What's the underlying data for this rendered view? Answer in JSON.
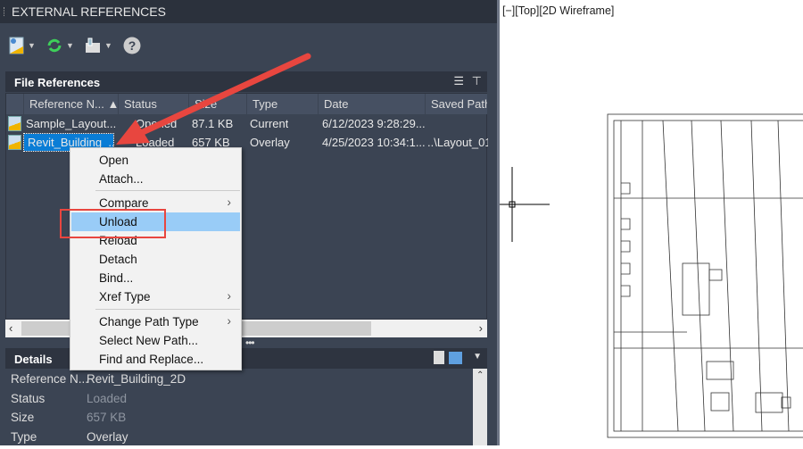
{
  "palette": {
    "title": "EXTERNAL REFERENCES"
  },
  "toolbar": {
    "icons": [
      "attach-dwg-icon",
      "refresh-icon",
      "change-path-icon",
      "help-icon"
    ]
  },
  "file_references": {
    "title": "File References",
    "columns": [
      "Reference N...",
      "Status",
      "Size",
      "Type",
      "Date",
      "Saved Path"
    ],
    "rows": [
      {
        "name": "Sample_Layout...",
        "status": "Opened",
        "size": "87.1 KB",
        "type": "Current",
        "date": "6/12/2023 9:28:29...",
        "saved_path": ""
      },
      {
        "name": "Revit_Building_...",
        "status": "Loaded",
        "size": "657 KB",
        "type": "Overlay",
        "date": "4/25/2023 10:34:1...",
        "saved_path": "..\\Layout_01"
      }
    ]
  },
  "context_menu": {
    "items": [
      {
        "label": "Open"
      },
      {
        "label": "Attach..."
      },
      {
        "label": "Compare",
        "submenu": true
      },
      {
        "label": "Unload",
        "highlighted": true
      },
      {
        "label": "Reload"
      },
      {
        "label": "Detach"
      },
      {
        "label": "Bind..."
      },
      {
        "label": "Xref Type",
        "submenu": true
      },
      {
        "label": "Change Path Type",
        "submenu": true
      },
      {
        "label": "Select New Path..."
      },
      {
        "label": "Find and Replace..."
      }
    ],
    "submenu_glyph": "›"
  },
  "details": {
    "title": "Details",
    "rows": [
      {
        "label": "Reference N...",
        "value": "Revit_Building_2D"
      },
      {
        "label": "Status",
        "value": "Loaded"
      },
      {
        "label": "Size",
        "value": "657 KB"
      },
      {
        "label": "Type",
        "value": "Overlay"
      }
    ]
  },
  "viewport": {
    "label": "[−][Top][2D Wireframe]"
  },
  "colors": {
    "highlight": "#99ccf7",
    "selection": "#0a7dd6",
    "annotation": "#e8463f"
  }
}
